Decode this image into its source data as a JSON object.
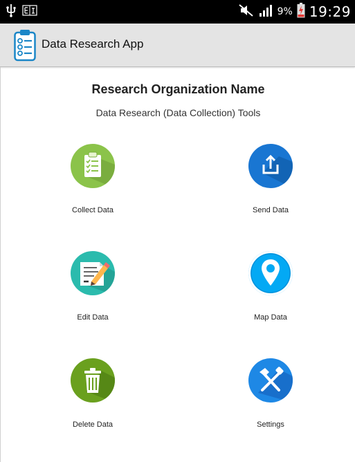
{
  "statusbar": {
    "battery_percent": "9%",
    "time": "19:29",
    "icons": [
      "usb-icon",
      "notification-icon",
      "mute-icon",
      "signal-icon",
      "battery-charging-icon"
    ]
  },
  "appbar": {
    "title": "Data Research App",
    "icon": "clipboard-checklist-icon"
  },
  "main": {
    "org_name": "Research Organization Name",
    "subtitle": "Data Research (Data Collection) Tools",
    "tiles": [
      {
        "label": "Collect Data",
        "icon": "clipboard-checklist-icon",
        "color": "#8BC34A"
      },
      {
        "label": "Send Data",
        "icon": "upload-icon",
        "color": "#1976D2"
      },
      {
        "label": "Edit Data",
        "icon": "edit-document-icon",
        "color": "#2BBBAD"
      },
      {
        "label": "Map Data",
        "icon": "map-pin-icon",
        "color": "#03A9F4"
      },
      {
        "label": "Delete Data",
        "icon": "trash-icon",
        "color": "#6AA01E"
      },
      {
        "label": "Settings",
        "icon": "tools-icon",
        "color": "#1E88E5"
      }
    ]
  }
}
